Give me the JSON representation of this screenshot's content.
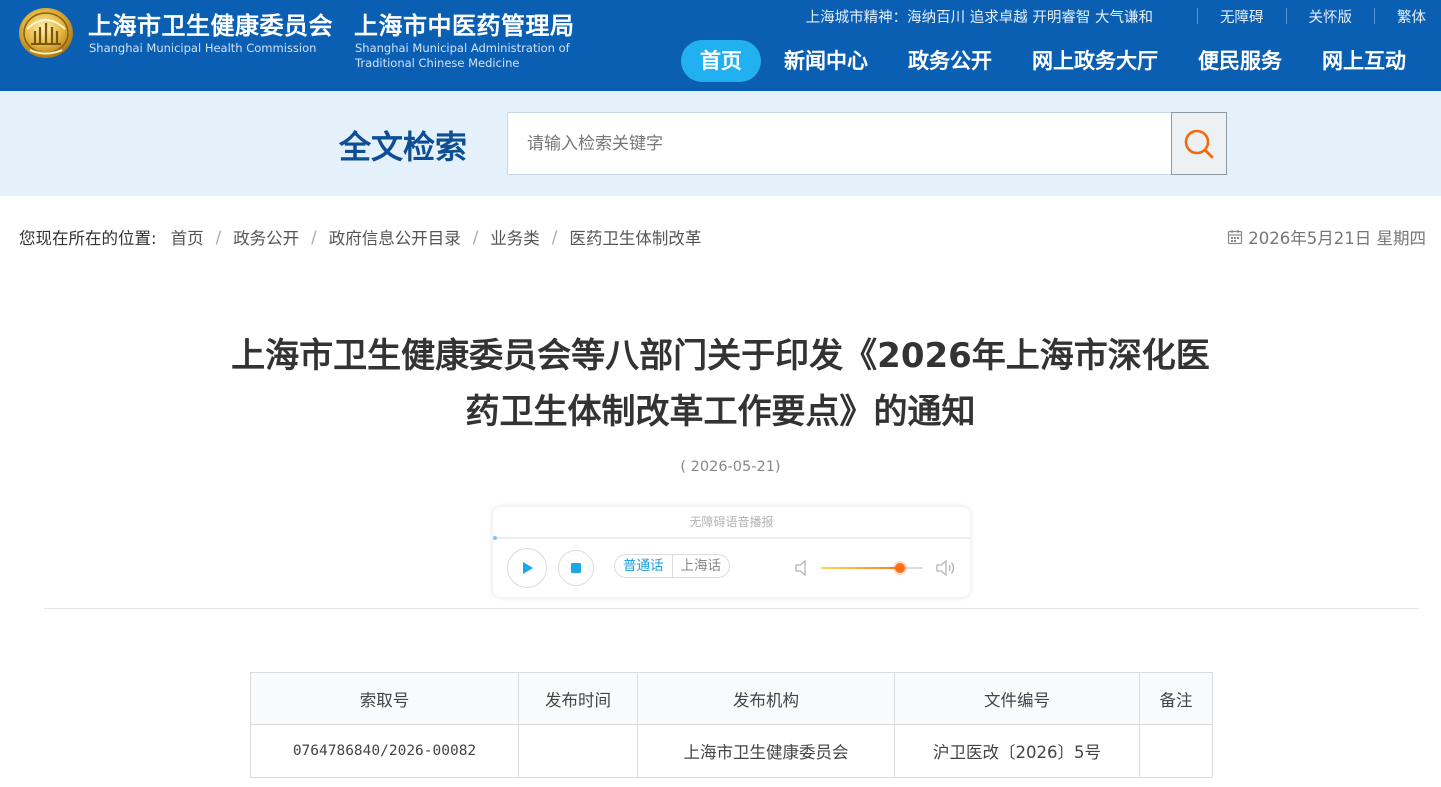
{
  "header": {
    "org_cn_1": "上海市卫生健康委员会",
    "org_en_1": "Shanghai Municipal Health Commission",
    "org_cn_2": "上海市中医药管理局",
    "org_en_2": "Shanghai Municipal Administration of Traditional Chinese Medicine",
    "brand_color": "#0b5fb3",
    "top_links": {
      "spirit": "上海城市精神：海纳百川 追求卓越 开明睿智 大气谦和",
      "accessible": "无障碍",
      "care": "关怀版",
      "traditional": "繁体"
    },
    "nav": [
      {
        "label": "首页",
        "active": true
      },
      {
        "label": "新闻中心",
        "active": false
      },
      {
        "label": "政务公开",
        "active": false
      },
      {
        "label": "网上政务大厅",
        "active": false
      },
      {
        "label": "便民服务",
        "active": false
      },
      {
        "label": "网上互动",
        "active": false
      }
    ],
    "nav_active_color": "#21b1f0"
  },
  "search": {
    "title": "全文检索",
    "value": "",
    "placeholder": "请输入检索关键字",
    "button_icon": "search-icon",
    "icon_color": "#f06a0f"
  },
  "breadcrumb": {
    "lead": "您现在所在的位置:",
    "items": [
      "首页",
      "政务公开",
      "政府信息公开目录",
      "业务类",
      "医药卫生体制改革"
    ],
    "separator": "/"
  },
  "current_date": "2026年5月21日 星期四",
  "article": {
    "title_line_1": "上海市卫生健康委员会等八部门关于印发《2026年上海市深化医",
    "title_line_2": "药卫生体制改革工作要点》的通知",
    "date": "( 2026-05-21)"
  },
  "player": {
    "label": "无障碍语音播报",
    "lang_mandarin": "普通话",
    "lang_shanghainese": "上海话",
    "volume_level": 0.77,
    "play_icon": "play-icon",
    "stop_icon": "stop-icon"
  },
  "info_table": {
    "headers": [
      "索取号",
      "发布时间",
      "发布机构",
      "文件编号",
      "备注"
    ],
    "row": [
      "0764786840/2026-00082",
      "",
      "上海市卫生健康委员会",
      "沪卫医改〔2026〕5号",
      ""
    ]
  }
}
